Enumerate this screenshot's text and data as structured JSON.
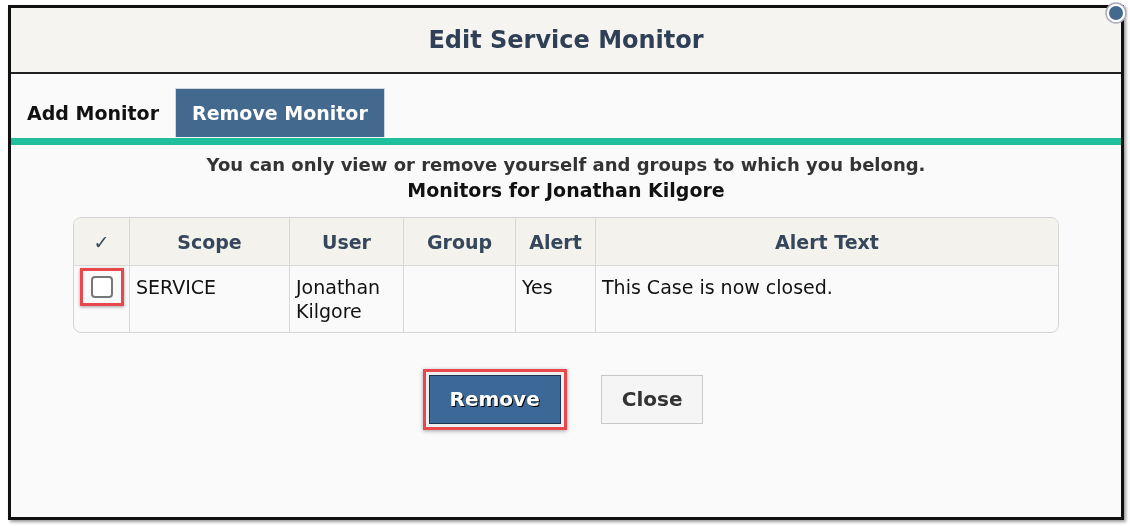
{
  "dialog": {
    "title": "Edit Service Monitor"
  },
  "tabs": [
    {
      "label": "Add Monitor",
      "selected": false
    },
    {
      "label": "Remove Monitor",
      "selected": true
    }
  ],
  "notice": "You can only view or remove yourself and groups to which you belong.",
  "subtitle": "Monitors for Jonathan Kilgore",
  "table": {
    "columns": [
      "✓",
      "Scope",
      "User",
      "Group",
      "Alert",
      "Alert Text"
    ],
    "rows": [
      {
        "checked": false,
        "highlighted": true,
        "cells": [
          "",
          "SERVICE",
          "Jonathan Kilgore",
          "",
          "Yes",
          "This Case is now closed."
        ]
      }
    ]
  },
  "buttons": [
    {
      "label": "Remove",
      "kind": "primary",
      "highlighted": true
    },
    {
      "label": "Close",
      "kind": "secondary",
      "highlighted": false
    }
  ]
}
